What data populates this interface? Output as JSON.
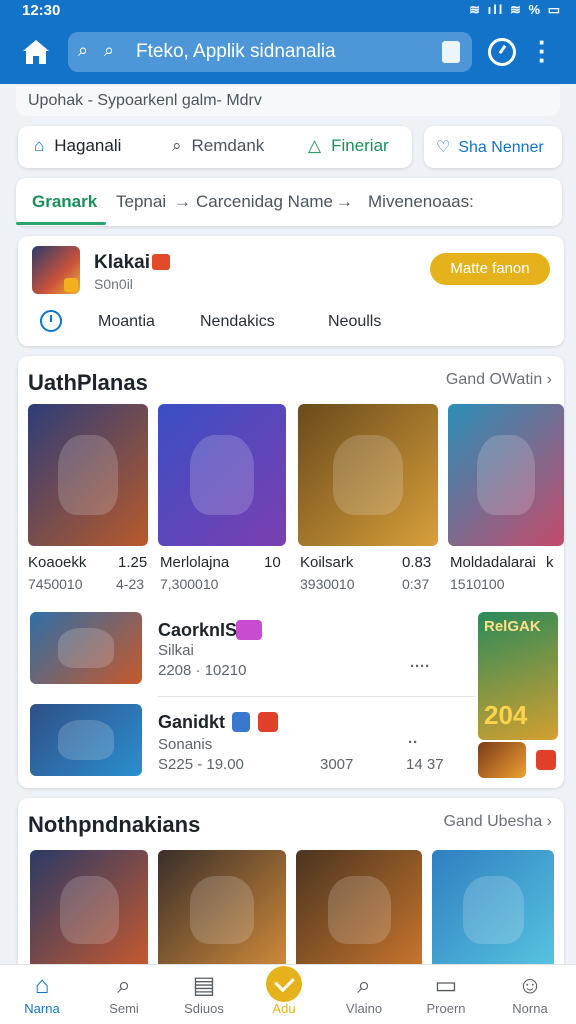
{
  "status_bar": {
    "time": "12:30",
    "indicators": "≋ ıll ≋ % ▭"
  },
  "app_bar": {
    "search_text": "Fteko, Applik sidnanalia",
    "icons": [
      "home-icon",
      "search-icon",
      "bag-icon",
      "clock-icon",
      "more-icon"
    ]
  },
  "breadcrumb": "Upohak - Sypoarkenl galm- Mdrv",
  "tabs": [
    {
      "label": "Haganali",
      "icon": "home-icon"
    },
    {
      "label": "Remdank",
      "icon": "search-icon"
    },
    {
      "label": "Fineriar",
      "icon": "triangle-icon"
    }
  ],
  "share_tab": {
    "label": "Sha Nenner",
    "icon": "pin-icon"
  },
  "filters": {
    "active": "Granark",
    "items": [
      "Tepnai",
      "Carcenidag Name",
      "Mivenenoaas:"
    ]
  },
  "profile": {
    "name": "Klakai",
    "sub": "S0n0il",
    "button": "Matte fanon",
    "links": [
      "Moantia",
      "Nendakics",
      "Neoulls"
    ]
  },
  "section1": {
    "title": "UathPlanas",
    "more": "Gand OWatin",
    "cards": [
      {
        "name": "Koaoekk",
        "value": "1.25",
        "sub": "7450010",
        "sub2": "4-23",
        "colors": [
          "#2d3d78",
          "#b85a2a"
        ]
      },
      {
        "name": "Merlolajna",
        "value": "10",
        "sub": "7,300010",
        "sub2": "",
        "colors": [
          "#3a4fc4",
          "#7b3fb0"
        ]
      },
      {
        "name": "Koilsark",
        "value": "0.83",
        "sub": "3930010",
        "sub2": "0:37",
        "colors": [
          "#6a4a1c",
          "#d8a03a"
        ]
      },
      {
        "name": "Moldadalarai",
        "value": "k",
        "sub": "1510100",
        "sub2": "",
        "colors": [
          "#2a8fb8",
          "#c44a6a"
        ]
      }
    ],
    "rows": [
      {
        "title": "CaorknIS:",
        "sub": "Silkai",
        "meta": "2208 · 10210",
        "dots": "····"
      },
      {
        "title": "Ganidkt",
        "sub": "Sonanis",
        "meta": "S225 - 19.00",
        "meta2": "3007",
        "meta3": "14 37",
        "dots": "··"
      }
    ],
    "side_card": {
      "title": "RelGAK",
      "value": "204"
    }
  },
  "section2": {
    "title": "Nothpndnakians",
    "more": "Gand Ubesha",
    "cards": [
      {
        "colors": [
          "#2b3a66",
          "#c7592e"
        ]
      },
      {
        "colors": [
          "#3a2e2a",
          "#d18b3a"
        ]
      },
      {
        "colors": [
          "#4a3420",
          "#c9762c"
        ]
      },
      {
        "colors": [
          "#2f7fc0",
          "#58c4e0"
        ]
      }
    ]
  },
  "bottom_nav": [
    {
      "label": "Narna",
      "icon": "home-icon",
      "active": true
    },
    {
      "label": "Semi",
      "icon": "search-icon"
    },
    {
      "label": "Sdiuos",
      "icon": "document-icon"
    },
    {
      "label": "Adu",
      "icon": "check-icon"
    },
    {
      "label": "Vlaino",
      "icon": "magnify-icon"
    },
    {
      "label": "Proern",
      "icon": "folder-icon"
    },
    {
      "label": "Norna",
      "icon": "user-icon"
    }
  ]
}
